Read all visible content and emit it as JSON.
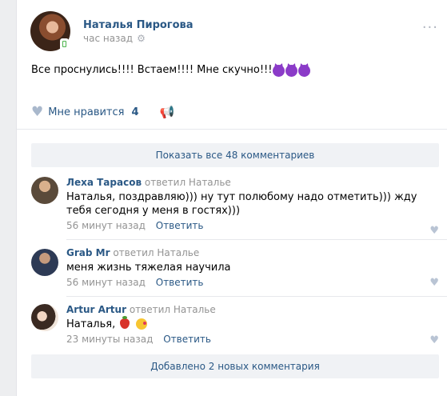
{
  "post": {
    "author": "Наталья Пирогова",
    "time": "час назад",
    "text": "Все проснулись!!!! Встаем!!!! Мне скучно!!!",
    "likes_label": "Мне нравится",
    "likes_count": "4"
  },
  "show_all_comments": "Показать все 48 комментариев",
  "comments": [
    {
      "name": "Леха Тарасов",
      "replied": "ответил Наталье",
      "text": "Наталья, поздравляю))) ну тут полюбому надо отметить))) жду тебя сегодня у меня в гостях)))",
      "time": "56 минут назад",
      "reply_label": "Ответить"
    },
    {
      "name": "Grab Mr",
      "replied": "ответил Наталье",
      "text": "меня жизнь тяжелая научила",
      "time": "56 минут назад",
      "reply_label": "Ответить"
    },
    {
      "name": "Artur Artur",
      "replied": "ответил Наталье",
      "text": "Наталья,",
      "time": "23 минуты назад",
      "reply_label": "Ответить"
    }
  ],
  "new_comments": "Добавлено 2 новых комментария",
  "colors": {
    "link": "#2a5885",
    "muted": "#939393",
    "bar_bg": "#f0f2f5"
  },
  "icons": [
    "settings-gear-icon",
    "more-dots-icon",
    "heart-icon",
    "share-megaphone-icon",
    "devil-emoji-icon",
    "strawberry-emoji-icon",
    "kiss-emoji-icon"
  ]
}
